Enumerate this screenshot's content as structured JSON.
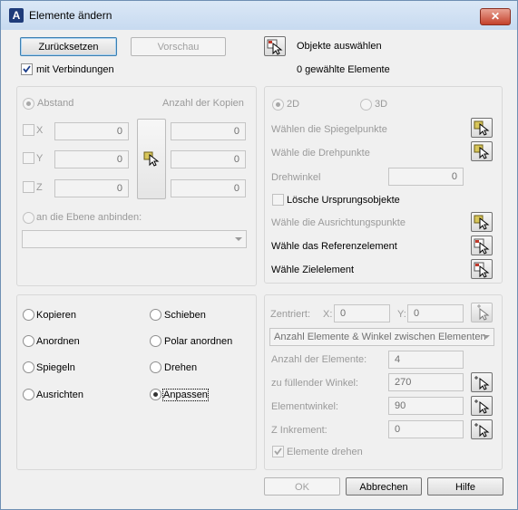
{
  "window": {
    "title": "Elemente ändern",
    "app_icon_glyph": "A",
    "close_glyph": "✕"
  },
  "top": {
    "reset_label": "Zurücksetzen",
    "preview_label": "Vorschau",
    "with_links_label": "mit Verbindungen",
    "with_links_checked": true,
    "select_objects_label": "Objekte auswählen",
    "selected_count_text": "0 gewählte Elemente"
  },
  "copy_panel": {
    "distance_label": "Abstand",
    "copies_header": "Anzahl der Kopien",
    "axes": [
      {
        "label": "X",
        "distance": "0",
        "copies": "0"
      },
      {
        "label": "Y",
        "distance": "0",
        "copies": "0"
      },
      {
        "label": "Z",
        "distance": "0",
        "copies": "0"
      }
    ],
    "bind_plane_label": "an die Ebene anbinden:",
    "plane_value": ""
  },
  "mirror_panel": {
    "option_2d": "2D",
    "option_3d": "3D",
    "mirror_points_label": "Wählen die Spiegelpunkte",
    "rotate_points_label": "Wähle die Drehpunkte",
    "rotation_angle_label": "Drehwinkel",
    "rotation_angle_value": "0",
    "delete_source_label": "Lösche Ursprungsobjekte",
    "align_points_label": "Wähle die Ausrichtungspunkte",
    "reference_element_label": "Wähle das Referenzelement",
    "target_element_label": "Wähle Zielelement"
  },
  "modes": {
    "left": [
      "Kopieren",
      "Anordnen",
      "Spiegeln",
      "Ausrichten"
    ],
    "right": [
      "Schieben",
      "Polar anordnen",
      "Drehen",
      "Anpassen"
    ],
    "selected": "Anpassen"
  },
  "polar_panel": {
    "center_label": "Zentriert:",
    "x_label": "X:",
    "x_value": "0",
    "y_label": "Y:",
    "y_value": "0",
    "method_value": "Anzahl Elemente & Winkel zwischen Elementen",
    "count_label": "Anzahl der Elemente:",
    "count_value": "4",
    "fill_angle_label": "zu füllender Winkel:",
    "fill_angle_value": "270",
    "element_angle_label": "Elementwinkel:",
    "element_angle_value": "90",
    "z_increment_label": "Z Inkrement:",
    "z_increment_value": "0",
    "rotate_elements_label": "Elemente drehen"
  },
  "footer": {
    "ok_label": "OK",
    "cancel_label": "Abbrechen",
    "help_label": "Hilfe"
  }
}
